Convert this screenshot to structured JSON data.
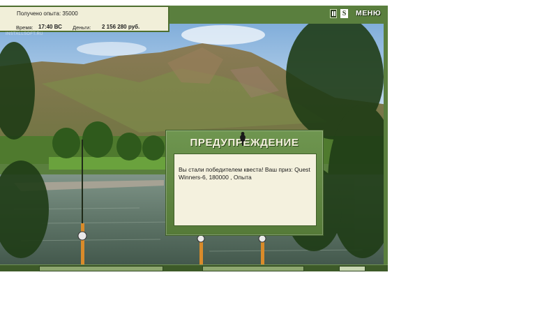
{
  "status": {
    "experience_text": "Получено опыта: 35000",
    "time_label": "Время:",
    "time_value": "17:40 ВС",
    "money_label": "Деньги:",
    "money_value": "2 156 280 руб."
  },
  "watermark": "INSTALLSOFT.RU",
  "controls": {
    "pause_icon": "pause-icon",
    "sound_label": "S",
    "menu_label": "МЕНЮ"
  },
  "dialog": {
    "title": "ПРЕДУПРЕЖДЕНИЕ",
    "message": "Вы стали победителем квеста! Ваш приз: Quest Winners-6, 180000 , Опыта"
  },
  "colors": {
    "panel_bg": "#f1efd9",
    "frame_green": "#5a7f3e",
    "dialog_green": "#6f9650",
    "dialog_body": "#f4f1de"
  }
}
